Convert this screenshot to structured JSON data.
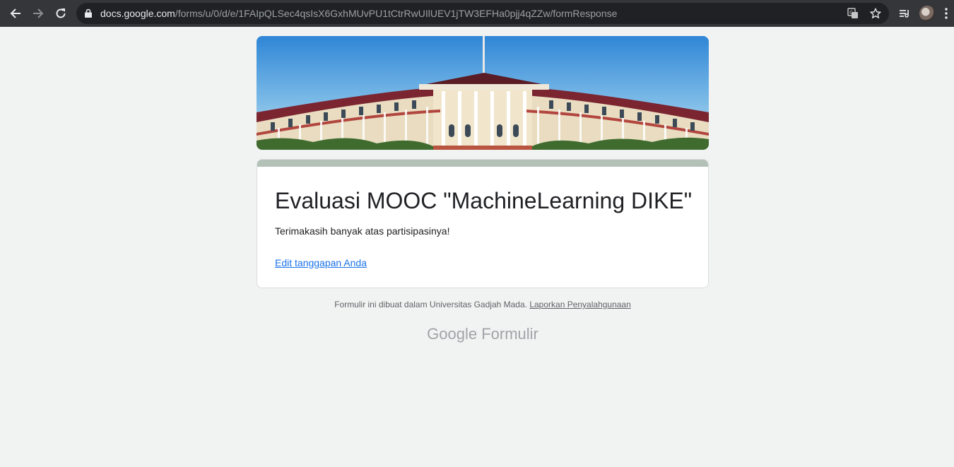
{
  "browser": {
    "url_host": "docs.google.com",
    "url_path": "/forms/u/0/d/e/1FAIpQLSec4qsIsX6GxhMUvPU1tCtrRwUIlUEV1jTW3EFHa0pjj4qZZw/formResponse"
  },
  "form": {
    "title": "Evaluasi MOOC \"MachineLearning DIKE\"",
    "confirmation": "Terimakasih banyak atas partisipasinya!",
    "edit_link": "Edit tanggapan Anda"
  },
  "footer": {
    "note": "Formulir ini dibuat dalam Universitas Gadjah Mada.",
    "abuse_link": "Laporkan Penyalahgunaan",
    "brand_google": "Google",
    "brand_product": "Formulir"
  },
  "colors": {
    "accent": "#b3c1b7",
    "link": "#1a73e8",
    "page_bg": "#f1f3f2"
  },
  "icons": [
    "back-arrow-icon",
    "forward-arrow-icon",
    "reload-icon",
    "lock-icon",
    "translate-icon",
    "star-icon",
    "reading-list-icon",
    "avatar",
    "menu-icon"
  ]
}
